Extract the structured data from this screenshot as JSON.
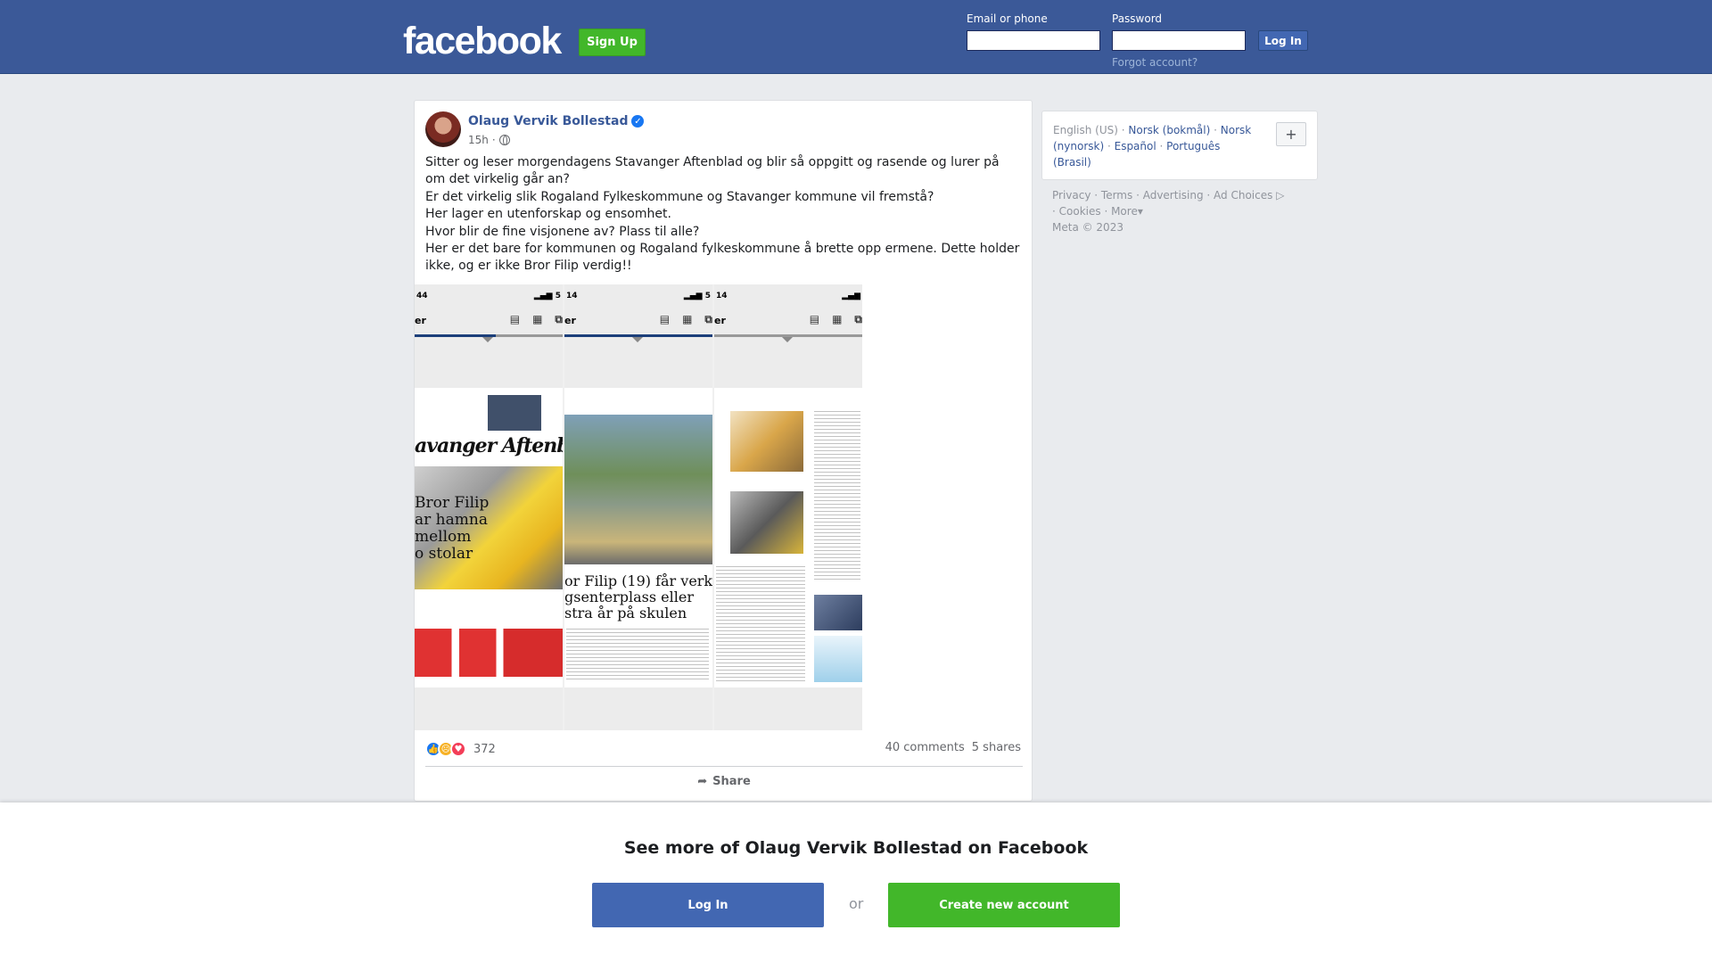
{
  "header": {
    "logo": "facebook",
    "signup_label": "Sign Up",
    "email_label": "Email or phone",
    "password_label": "Password",
    "login_label": "Log In",
    "forgot_label": "Forgot account?",
    "email_value": "",
    "password_value": ""
  },
  "post": {
    "author": "Olaug Vervik Bollestad",
    "time": "15h",
    "separator": "·",
    "text": [
      "Sitter og leser morgendagens Stavanger Aftenblad og blir så oppgitt og rasende og lurer på om det virkelig går an?",
      "Er det virkelig slik Rogaland Fylkeskommune og Stavanger kommune vil fremstå?",
      "Her lager en utenforskap og ensomhet.",
      "Hvor blir de fine visjonene av? Plass til alle?",
      "Her er det bare for kommunen og Rogaland fylkeskommune å brette opp ermene. Dette holder ikke, og er ikke Bror Filip verdig!!"
    ],
    "images": [
      {
        "status_time": "44",
        "toolbar_label": "er",
        "masthead": "avanger Aftenbla",
        "headline": "Bror Filip\nar hamna\nmellom\no stolar"
      },
      {
        "status_time": "14",
        "toolbar_label": "er",
        "headline": "or Filip (19) får verken\ngsenterplass eller\nstra år på skulen"
      },
      {
        "status_time": "14",
        "toolbar_label": "er"
      }
    ],
    "reaction_count": "372",
    "comments": "40 comments",
    "shares": "5 shares",
    "share_label": "Share"
  },
  "languages": {
    "current": "English (US)",
    "others": [
      "Norsk (bokmål)",
      "Norsk (nynorsk)",
      "Español",
      "Português (Brasil)"
    ],
    "plus": "+"
  },
  "footer": {
    "links": [
      "Privacy",
      "Terms",
      "Advertising",
      "Ad Choices",
      "Cookies",
      "More"
    ],
    "copyright": "Meta © 2023"
  },
  "bottom": {
    "title": "See more of Olaug Vervik Bollestad on Facebook",
    "login_label": "Log In",
    "or_label": "or",
    "create_label": "Create new account"
  },
  "colors": {
    "brand": "#3b5998",
    "green": "#42b72a",
    "link": "#385898"
  }
}
